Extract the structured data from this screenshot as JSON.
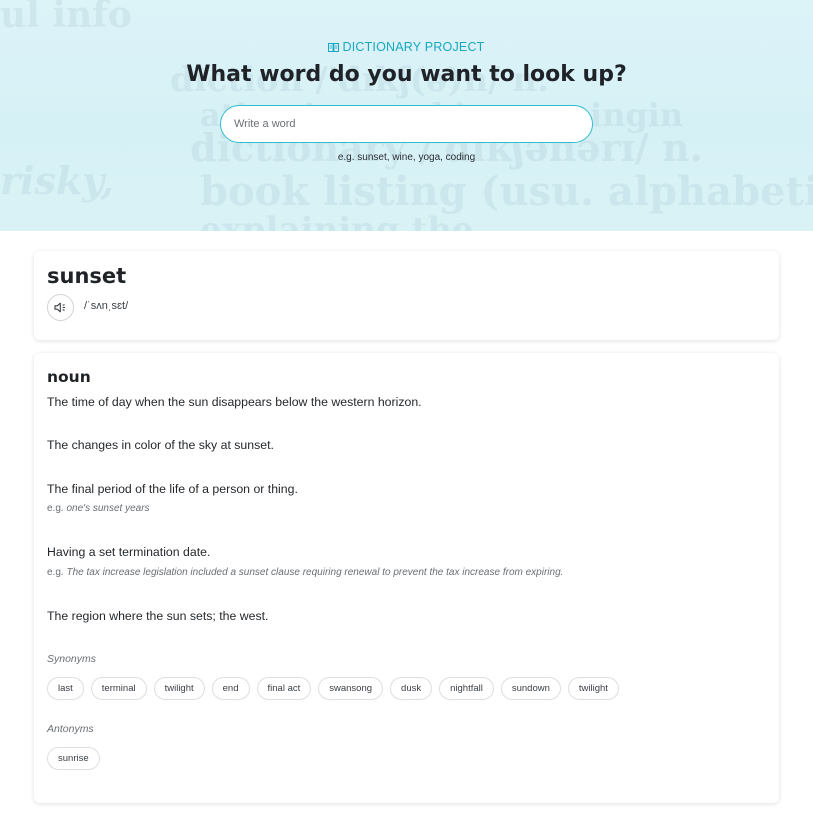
{
  "header": {
    "brand_label": "DICTIONARY PROJECT",
    "brand_icon": "book-icon",
    "title": "What word do you want to look up?",
    "search": {
      "value": "",
      "placeholder": "Write a word"
    },
    "hint": "e.g. sunset, wine, yoga, coding",
    "accent_color": "#17a8c0",
    "background_words": [
      "ul info",
      "diction /'dɪkʃ(ə)n/ n.",
      "ation in speaking or singin",
      "dictionary /'dɪkʃənərɪ/ n.",
      "risky,",
      "book listing (usu. alphabetic",
      "explaining the"
    ]
  },
  "word": {
    "text": "sunset",
    "phonetic": "/ˈsʌnˌsɛt/",
    "audio_icon": "speaker-icon"
  },
  "meanings": [
    {
      "part_of_speech": "noun",
      "definitions": [
        {
          "text": "The time of day when the sun disappears below the western horizon.",
          "example": ""
        },
        {
          "text": "The changes in color of the sky at sunset.",
          "example": ""
        },
        {
          "text": "The final period of the life of a person or thing.",
          "example_prefix": "e.g.",
          "example": "one's sunset years"
        },
        {
          "text": "Having a set termination date.",
          "example_prefix": "e.g.",
          "example": "The tax increase legislation included a sunset clause requiring renewal to prevent the tax increase from expiring."
        },
        {
          "text": "The region where the sun sets; the west.",
          "example": ""
        }
      ],
      "synonyms_label": "Synonyms",
      "synonyms": [
        "last",
        "terminal",
        "twilight",
        "end",
        "final act",
        "swansong",
        "dusk",
        "nightfall",
        "sundown",
        "twilight"
      ],
      "antonyms_label": "Antonyms",
      "antonyms": [
        "sunrise"
      ]
    }
  ]
}
